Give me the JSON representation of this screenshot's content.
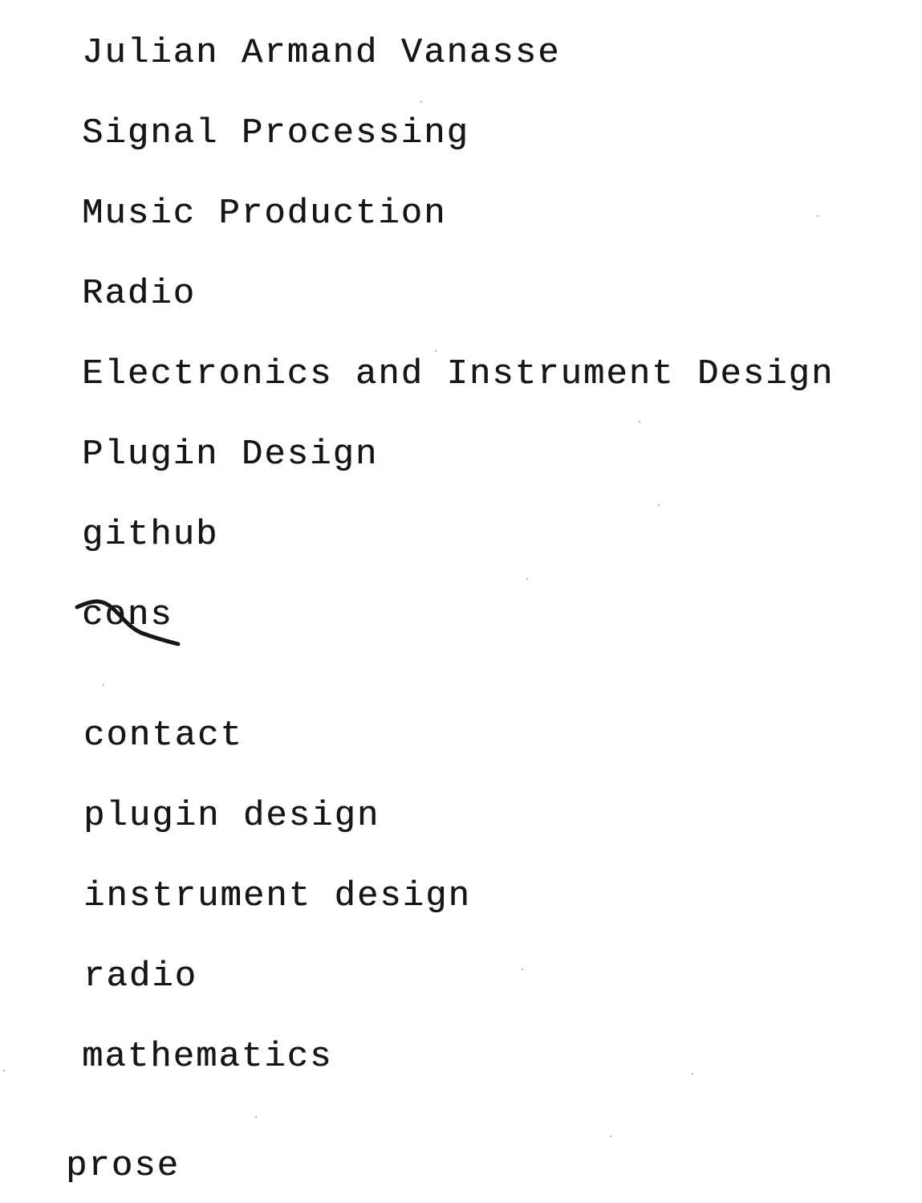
{
  "document": {
    "lines": [
      "Julian Armand Vanasse",
      "Signal Processing",
      "Music Production",
      "Radio",
      "Electronics and Instrument Design",
      "Plugin Design",
      "github",
      "cons",
      "contact",
      "plugin design",
      "instrument design",
      "radio",
      "mathematics",
      "prose"
    ]
  },
  "colors": {
    "ink": "#161616",
    "paper": "#ffffff"
  }
}
